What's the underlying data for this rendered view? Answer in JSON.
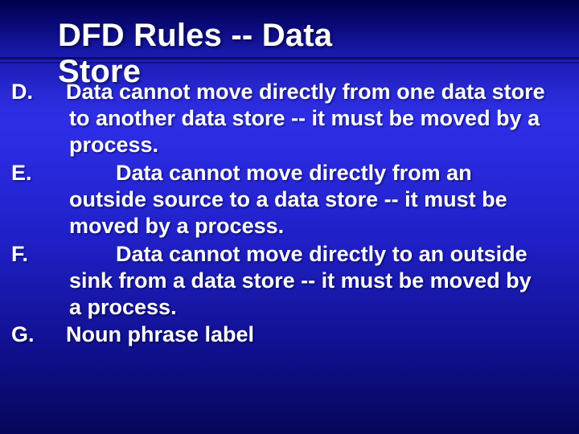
{
  "slide": {
    "title_line1": "DFD Rules -- Data",
    "title_line2": "Store",
    "items": [
      {
        "marker": "D.",
        "text": "Data cannot move directly from one data store to another data store -- it must be moved by a process."
      },
      {
        "marker": "E.",
        "text": "Data cannot move directly from an outside source to a data store -- it must be moved by a process."
      },
      {
        "marker": "F.",
        "text": "Data cannot move directly to an outside sink from a data store -- it must be moved by a process."
      },
      {
        "marker": "G.",
        "text": "Noun phrase label"
      }
    ]
  }
}
